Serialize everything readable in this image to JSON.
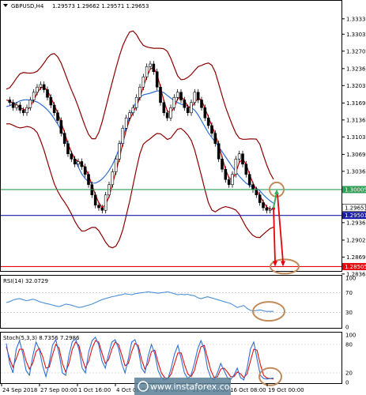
{
  "header": {
    "symbol_tf": "GBPUSD,H4",
    "ohlc": "1.29573 1.29662 1.29571 1.29653"
  },
  "price_axis": {
    "ticks": [
      "1.33330",
      "1.33030",
      "1.32700",
      "1.32360",
      "1.32030",
      "1.31690",
      "1.31360",
      "1.31030",
      "1.30690",
      "1.30360",
      "1.30030",
      "1.29690",
      "1.29360",
      "1.29020",
      "1.28690",
      "1.28360"
    ],
    "ylim": [
      1.2845,
      1.3365
    ]
  },
  "levels": [
    {
      "label": "1.30005",
      "value": 1.30005,
      "color": "#2e9e57"
    },
    {
      "label": "1.29653",
      "value": 1.29653,
      "color": "#000000",
      "current": true
    },
    {
      "label": "1.29501",
      "value": 1.29501,
      "color": "#1a1aa8"
    },
    {
      "label": "1.28505",
      "value": 1.28505,
      "color": "#e8000b"
    }
  ],
  "time_axis": {
    "labels": [
      "24 Sep 2018",
      "27 Sep 00:00",
      "1 Oct 16:00",
      "4 Oct 08:00",
      "9 Oct 00:00",
      "11 Oct 16:00",
      "16 Oct 08:00",
      "19 Oct 00:00"
    ]
  },
  "rsi": {
    "label": "RSI(14) 32.0729",
    "ticks": [
      "100",
      "70",
      "30",
      "0"
    ],
    "values": [
      50,
      52,
      55,
      57,
      58,
      56,
      54,
      55,
      57,
      55,
      52,
      50,
      48,
      47,
      45,
      43,
      42,
      44,
      47,
      46,
      44,
      42,
      40,
      41,
      43,
      45,
      47,
      50,
      53,
      56,
      58,
      60,
      62,
      63,
      65,
      66,
      68,
      67,
      66,
      68,
      69,
      70,
      71,
      72,
      71,
      70,
      69,
      70,
      71,
      72,
      70,
      68,
      66,
      67,
      66,
      67,
      65,
      64,
      60,
      58,
      60,
      62,
      60,
      58,
      56,
      54,
      52,
      50,
      48,
      44,
      40,
      42,
      44,
      38,
      34,
      33,
      34,
      35,
      33,
      32,
      32,
      32
    ]
  },
  "stoch": {
    "label": "Stoch(5,3,3) 8.7356 7.2986",
    "ticks": [
      "100",
      "80",
      "20",
      "0"
    ],
    "k_values": [
      82,
      40,
      20,
      70,
      88,
      60,
      25,
      15,
      55,
      85,
      70,
      35,
      12,
      40,
      78,
      90,
      60,
      20,
      15,
      58,
      86,
      92,
      70,
      30,
      20,
      65,
      88,
      95,
      80,
      45,
      30,
      60,
      85,
      90,
      72,
      40,
      20,
      50,
      85,
      90,
      70,
      30,
      20,
      55,
      80,
      60,
      25,
      10,
      5,
      8,
      30,
      60,
      78,
      50,
      20,
      8,
      15,
      40,
      70,
      88,
      70,
      30,
      10,
      5,
      20,
      40,
      25,
      10,
      6,
      15,
      30,
      10,
      5,
      30,
      70,
      85,
      50,
      15,
      8,
      7,
      8,
      9
    ],
    "d_values": [
      75,
      50,
      32,
      50,
      70,
      70,
      45,
      28,
      40,
      65,
      72,
      55,
      30,
      32,
      58,
      80,
      72,
      40,
      22,
      40,
      70,
      85,
      78,
      50,
      30,
      45,
      72,
      88,
      85,
      62,
      40,
      48,
      70,
      85,
      80,
      58,
      35,
      40,
      65,
      82,
      78,
      48,
      28,
      40,
      65,
      68,
      42,
      20,
      10,
      8,
      18,
      40,
      62,
      62,
      38,
      18,
      12,
      25,
      52,
      75,
      78,
      52,
      25,
      10,
      12,
      28,
      30,
      22,
      12,
      12,
      22,
      18,
      10,
      18,
      45,
      70,
      68,
      38,
      15,
      9,
      8,
      7
    ]
  },
  "watermark": "www.instaforex.com",
  "colors": {
    "price_line": "#cc0000",
    "ma_blue": "#2f6fd6",
    "bands": "#8b0000",
    "rsi": "#4a8fd6",
    "stoch_k": "#2f6fd6",
    "stoch_d": "#e01010",
    "annotation": "#c08a5a",
    "arrow": "#e8000b",
    "arrow_up": "#33b05a"
  },
  "chart_data": [
    {
      "type": "line",
      "title": "GBPUSD,H4",
      "series": [
        {
          "name": "GBPUSD,H4",
          "values": [
            1.3175,
            1.317,
            1.316,
            1.3165,
            1.3155,
            1.315,
            1.316,
            1.3175,
            1.319,
            1.32,
            1.3205,
            1.3195,
            1.318,
            1.3165,
            1.315,
            1.3135,
            1.311,
            1.309,
            1.307,
            1.306,
            1.305,
            1.3055,
            1.3045,
            1.303,
            1.301,
            1.299,
            1.297,
            1.2965,
            1.296,
            1.299,
            1.301,
            1.3035,
            1.306,
            1.309,
            1.312,
            1.314,
            1.315,
            1.316,
            1.318,
            1.32,
            1.322,
            1.324,
            1.3245,
            1.323,
            1.32,
            1.317,
            1.315,
            1.314,
            1.316,
            1.318,
            1.319,
            1.3175,
            1.316,
            1.315,
            1.317,
            1.319,
            1.3175,
            1.316,
            1.314,
            1.3125,
            1.311,
            1.309,
            1.306,
            1.304,
            1.302,
            1.301,
            1.303,
            1.306,
            1.307,
            1.305,
            1.303,
            1.301,
            1.3,
            1.299,
            1.2975,
            1.2965,
            1.296,
            1.2962,
            1.2965
          ]
        }
      ],
      "ylim": [
        1.2845,
        1.3365
      ],
      "horizontal_levels": [
        1.30005,
        1.29501,
        1.28505
      ]
    },
    {
      "type": "line",
      "title": "RSI(14) 32.0729",
      "ylim": [
        0,
        100
      ]
    },
    {
      "type": "line",
      "title": "Stoch(5,3,3) 8.7356 7.2986",
      "ylim": [
        0,
        100
      ]
    }
  ]
}
